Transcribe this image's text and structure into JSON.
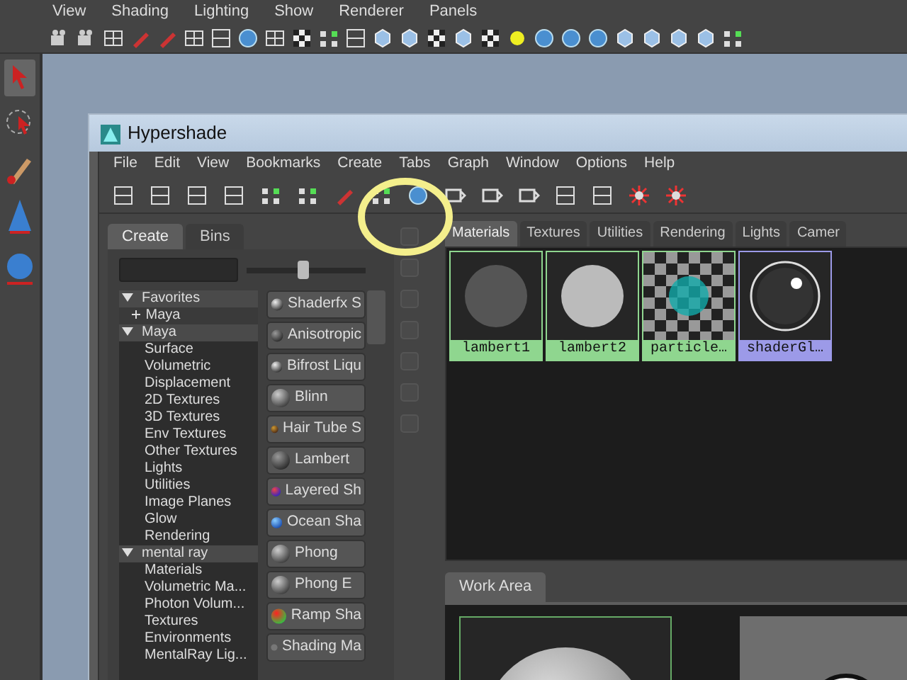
{
  "app_menu": [
    "View",
    "Shading",
    "Lighting",
    "Show",
    "Renderer",
    "Panels"
  ],
  "window": {
    "title": "Hypershade"
  },
  "menu": [
    "File",
    "Edit",
    "View",
    "Bookmarks",
    "Create",
    "Tabs",
    "Graph",
    "Window",
    "Options",
    "Help"
  ],
  "left_tabs": [
    {
      "label": "Create",
      "selected": true
    },
    {
      "label": "Bins",
      "selected": false
    }
  ],
  "size_slider": {
    "level": 0.48
  },
  "tree": [
    {
      "label": "Favorites",
      "expanded": true,
      "children": [
        {
          "label": "Maya",
          "expanded": false
        }
      ]
    },
    {
      "label": "Maya",
      "expanded": true,
      "children": [
        {
          "label": "Surface"
        },
        {
          "label": "Volumetric"
        },
        {
          "label": "Displacement"
        },
        {
          "label": "2D Textures"
        },
        {
          "label": "3D Textures"
        },
        {
          "label": "Env Textures"
        },
        {
          "label": "Other Textures"
        },
        {
          "label": "Lights"
        },
        {
          "label": "Utilities"
        },
        {
          "label": "Image Planes"
        },
        {
          "label": "Glow"
        },
        {
          "label": "Rendering"
        }
      ]
    },
    {
      "label": "mental ray",
      "expanded": true,
      "children": [
        {
          "label": "Materials"
        },
        {
          "label": "Volumetric Ma..."
        },
        {
          "label": "Photon Volum..."
        },
        {
          "label": "Textures"
        },
        {
          "label": "Environments"
        },
        {
          "label": "MentalRay Lig..."
        }
      ]
    }
  ],
  "shaders": [
    {
      "label": "Shaderfx S",
      "kind": "glossy"
    },
    {
      "label": "Anisotropic",
      "kind": "dark"
    },
    {
      "label": "Bifrost Liqu",
      "kind": "glossy"
    },
    {
      "label": "Blinn",
      "kind": "shaded"
    },
    {
      "label": "Hair Tube S",
      "kind": "hair"
    },
    {
      "label": "Lambert",
      "kind": "dark"
    },
    {
      "label": "Layered Sh",
      "kind": "layered"
    },
    {
      "label": "Ocean Sha",
      "kind": "ocean"
    },
    {
      "label": "Phong",
      "kind": "shaded"
    },
    {
      "label": "Phong E",
      "kind": "shaded"
    },
    {
      "label": "Ramp Sha",
      "kind": "ramp"
    },
    {
      "label": "Shading Ma",
      "kind": "flat"
    }
  ],
  "right_tabs": [
    {
      "label": "Materials",
      "selected": true
    },
    {
      "label": "Textures",
      "selected": false
    },
    {
      "label": "Utilities",
      "selected": false
    },
    {
      "label": "Rendering",
      "selected": false
    },
    {
      "label": "Lights",
      "selected": false
    },
    {
      "label": "Camer",
      "selected": false
    }
  ],
  "materials": [
    {
      "name": "lambert1",
      "kind": "dark",
      "color": "#8fd68f"
    },
    {
      "name": "lambert2",
      "kind": "light",
      "color": "#8fd68f"
    },
    {
      "name": "particle…",
      "kind": "checker",
      "color": "#8fd68f"
    },
    {
      "name": "shaderGl…",
      "kind": "glossy",
      "color": "#9c9ae8"
    }
  ],
  "work_area": {
    "tab": "Work Area"
  }
}
